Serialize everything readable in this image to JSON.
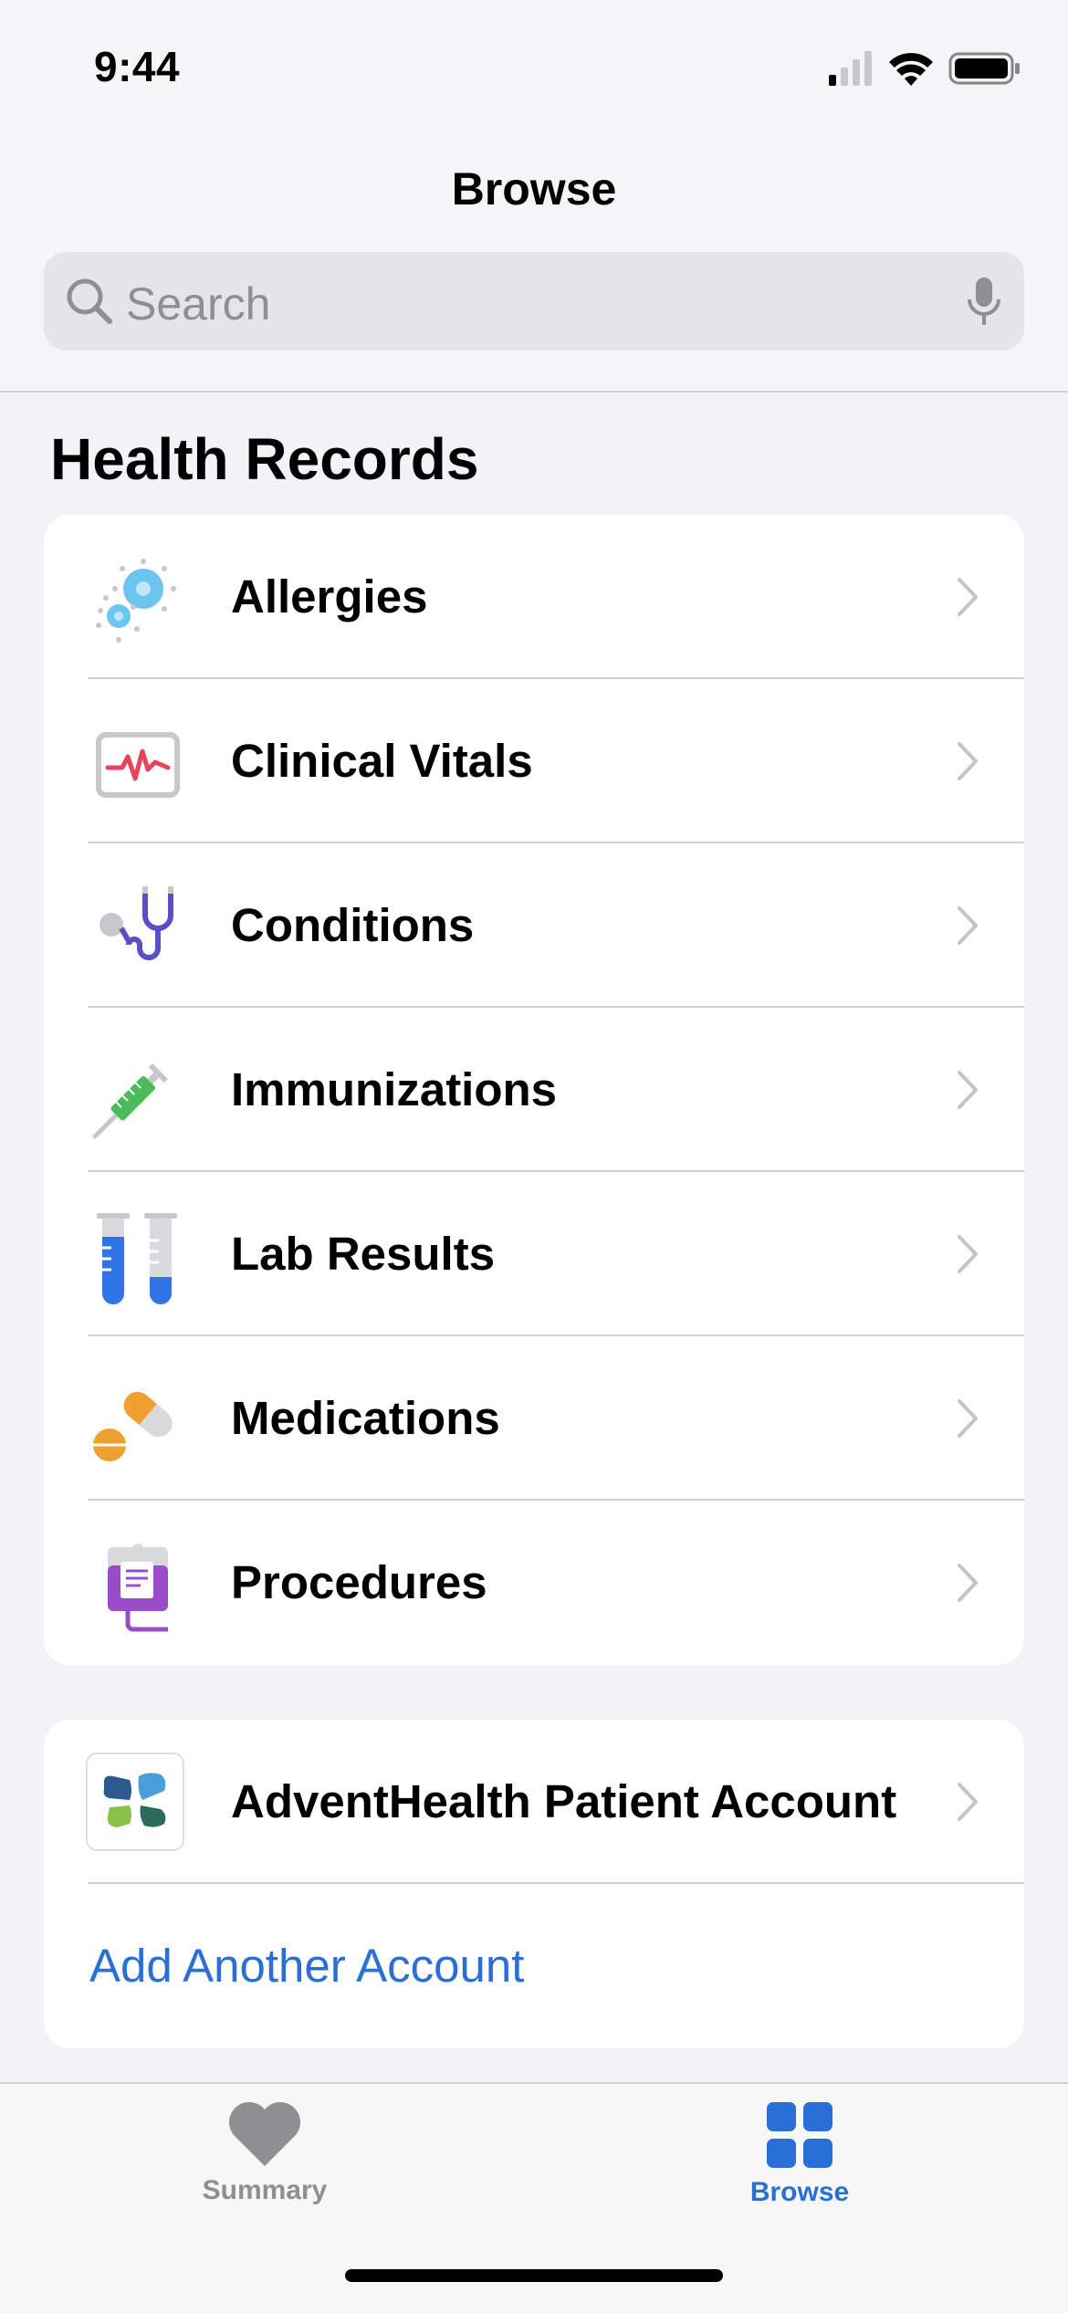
{
  "status_bar": {
    "time": "9:44"
  },
  "nav": {
    "title": "Browse"
  },
  "search": {
    "placeholder": "Search"
  },
  "health_records": {
    "title": "Health Records",
    "items": [
      {
        "label": "Allergies",
        "icon": "allergies-icon"
      },
      {
        "label": "Clinical Vitals",
        "icon": "clinical-vitals-icon"
      },
      {
        "label": "Conditions",
        "icon": "stethoscope-icon"
      },
      {
        "label": "Immunizations",
        "icon": "syringe-icon"
      },
      {
        "label": "Lab Results",
        "icon": "test-tubes-icon"
      },
      {
        "label": "Medications",
        "icon": "pills-icon"
      },
      {
        "label": "Procedures",
        "icon": "iv-bag-icon"
      }
    ]
  },
  "accounts": {
    "account_name": "AdventHealth Patient Account",
    "add_account_label": "Add Another Account"
  },
  "tab_bar": {
    "tabs": [
      {
        "label": "Summary",
        "icon": "heart-icon",
        "active": false
      },
      {
        "label": "Browse",
        "icon": "grid-icon",
        "active": true
      }
    ]
  },
  "colors": {
    "accent": "#2a6fd6",
    "inactive_tab": "#8e8e93",
    "background": "#f2f2f7"
  }
}
